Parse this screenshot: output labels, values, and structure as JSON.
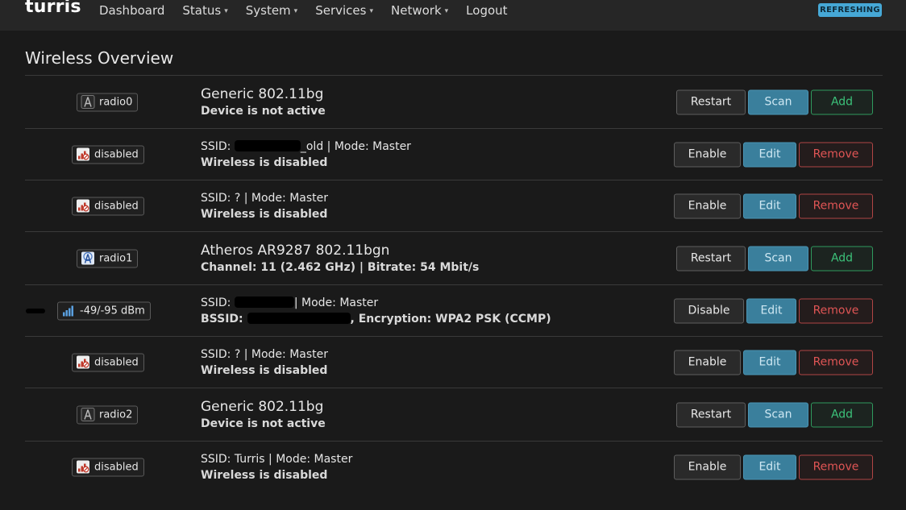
{
  "header": {
    "brand": "turris",
    "nav": [
      {
        "label": "Dashboard",
        "caret": false
      },
      {
        "label": "Status",
        "caret": true
      },
      {
        "label": "System",
        "caret": true
      },
      {
        "label": "Services",
        "caret": true
      },
      {
        "label": "Network",
        "caret": true
      },
      {
        "label": "Logout",
        "caret": false
      }
    ],
    "refresh_badge": "REFRESHING"
  },
  "page_title": "Wireless Overview",
  "rows": [
    {
      "badge": "radio0",
      "line1": "Generic 802.11bg",
      "line2": "Device is not active",
      "buttons": [
        "Restart",
        "Scan",
        "Add"
      ]
    },
    {
      "badge": "disabled",
      "line1_prefix": "SSID: ",
      "line1_suffix": "_old | Mode: Master",
      "line2": "Wireless is disabled",
      "buttons": [
        "Enable",
        "Edit",
        "Remove"
      ]
    },
    {
      "badge": "disabled",
      "line1": "SSID: ? | Mode: Master",
      "line2": "Wireless is disabled",
      "buttons": [
        "Enable",
        "Edit",
        "Remove"
      ]
    },
    {
      "badge": "radio1",
      "line1": "Atheros AR9287 802.11bgn",
      "line2": "Channel: 11 (2.462 GHz) | Bitrate: 54 Mbit/s",
      "buttons": [
        "Restart",
        "Scan",
        "Add"
      ]
    },
    {
      "badge": "-49/-95 dBm",
      "line1_prefix": "SSID: ",
      "line1_suffix": "| Mode: Master",
      "line2_prefix": "BSSID: ",
      "line2_suffix": ", Encryption: WPA2 PSK (CCMP)",
      "buttons": [
        "Disable",
        "Edit",
        "Remove"
      ]
    },
    {
      "badge": "disabled",
      "line1": "SSID: ? | Mode: Master",
      "line2": "Wireless is disabled",
      "buttons": [
        "Enable",
        "Edit",
        "Remove"
      ]
    },
    {
      "badge": "radio2",
      "line1": "Generic 802.11bg",
      "line2": "Device is not active",
      "buttons": [
        "Restart",
        "Scan",
        "Add"
      ]
    },
    {
      "badge": "disabled",
      "line1": "SSID: Turris | Mode: Master",
      "line2": "Wireless is disabled",
      "buttons": [
        "Enable",
        "Edit",
        "Remove"
      ]
    }
  ],
  "colors": {
    "primary": "#3a7f9c",
    "add": "#3cc27a",
    "remove": "#e05555",
    "refresh": "#46a8d6"
  }
}
